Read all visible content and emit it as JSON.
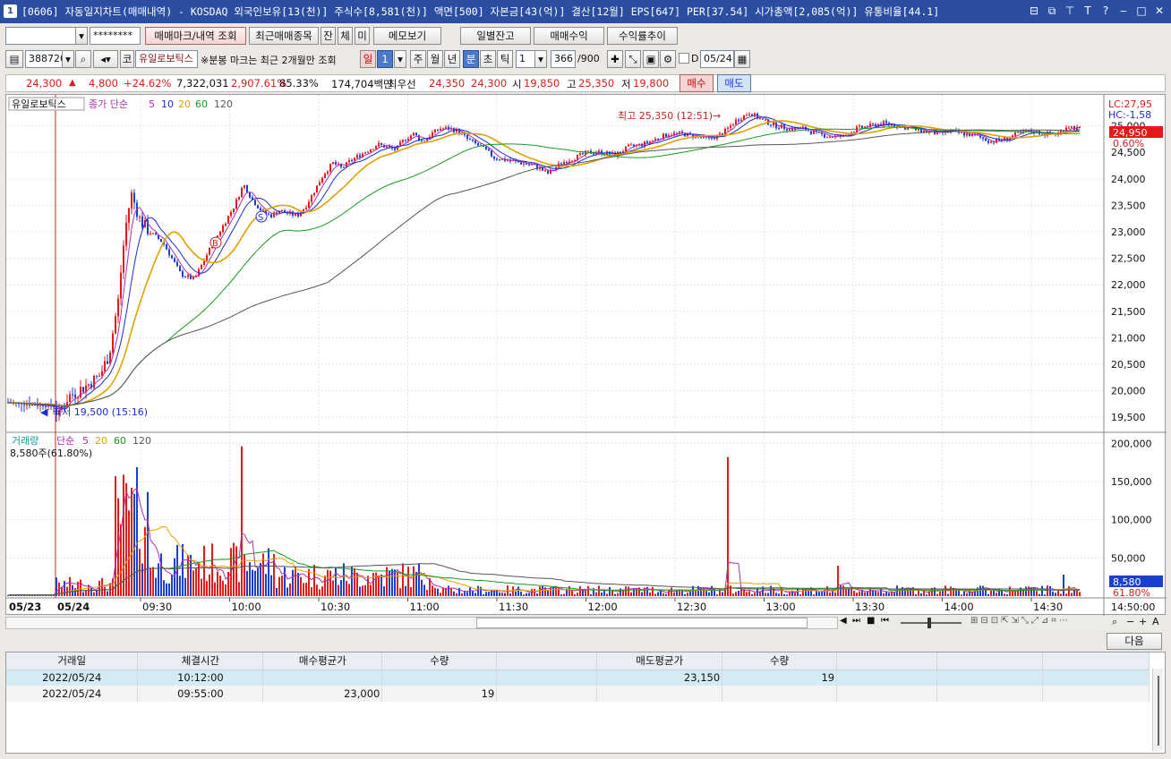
{
  "window": {
    "icon": "1",
    "title": "[0606] 자동일지차트(매매내역) - KOSDAQ 외국인보유[13(천)] 주식수[8,581(천)] 액면[500] 자본금[43(억)] 결산[12월] EPS[647] PER[37.54] 시가총액[2,085(억)] 유통비율[44.1]",
    "controls": [
      "⊟",
      "⧉",
      "⊤",
      "T",
      "?",
      "‒",
      "□",
      "✕"
    ]
  },
  "toolbar1": {
    "account_value": "",
    "password_mask": "********",
    "btn_trade_mark": "매매마크/내역 조회",
    "btn_recent": "최근매매종목",
    "btn_jan": "잔",
    "btn_che": "체",
    "btn_mi": "미",
    "btn_memo": "메모보기",
    "btn_daily_balance": "일별잔고",
    "btn_trade_profit": "매매수익",
    "btn_return_trend": "수익률추이"
  },
  "toolbar2": {
    "code": "388720",
    "market_badge": "코",
    "stock_name": "유일로보틱스",
    "notice": "※분봉 마크는 최근 2개월만 조회",
    "period_day": "일",
    "period_n": "1",
    "period_week": "주",
    "period_month": "월",
    "period_year": "년",
    "period_min": "분",
    "period_sec": "초",
    "period_tick": "틱",
    "tick_n": "1",
    "count": "366",
    "count_max": "/900",
    "d_label": "D",
    "date": "05/24"
  },
  "quote": {
    "price": "24,300",
    "up_arrow": "▲",
    "change": "4,800",
    "change_pct": "+24.62%",
    "volume": "7,322,031",
    "vol_ratio": "2,907.61%",
    "turnover": "85.33%",
    "amount": "174,704백만",
    "best_label": "최우선",
    "ask": "24,350",
    "bid": "24,300",
    "open_label": "시",
    "open": "19,850",
    "high_label": "고",
    "high": "25,350",
    "low_label": "저",
    "low": "19,800",
    "buy_btn": "매수",
    "sell_btn": "매도"
  },
  "chart_data": {
    "type": "candlestick",
    "price_panel": {
      "legend_name": "유일로보틱스",
      "legend_ma": "종가 단순",
      "ma_periods": [
        "5",
        "10",
        "20",
        "60",
        "120"
      ],
      "ma_colors": [
        "#1a2ec9",
        "#111111",
        "#e0a000",
        "#169c1e",
        "#555555"
      ],
      "y_ticks": [
        "25,000",
        "24,500",
        "24,000",
        "23,500",
        "23,000",
        "22,500",
        "22,000",
        "21,500",
        "21,000",
        "20,500",
        "20,000",
        "19,500"
      ],
      "ylim": [
        19300,
        25450
      ],
      "high_annotation": "최고 25,350 (12:51)",
      "low_annotation": "최저 19,500 (15:16)",
      "lc_label": "LC:27,95",
      "hc_label": "HC:-1,58",
      "last_price_label": "24,950",
      "last_pct_label": "0.60%",
      "marks": [
        "B",
        "S"
      ],
      "close_series_x": [
        0,
        55,
        56,
        70,
        90,
        105,
        115,
        125,
        130,
        135,
        140,
        150,
        160,
        175,
        185,
        195,
        210,
        225,
        235,
        245,
        255,
        265,
        275,
        285,
        295,
        305,
        315,
        325,
        335,
        345,
        355,
        365,
        375,
        385,
        395,
        405,
        415,
        425,
        435,
        445,
        455,
        465,
        475,
        485,
        495,
        505,
        515,
        525,
        535,
        545,
        560,
        575,
        590,
        605,
        620,
        635,
        650,
        665,
        680,
        695,
        710,
        725,
        740,
        755,
        770,
        785,
        800,
        815,
        830,
        845,
        860,
        875,
        890,
        905,
        920,
        935,
        950,
        965,
        980,
        995,
        1010,
        1025,
        1040,
        1055,
        1070,
        1085,
        1100,
        1115,
        1130,
        1145,
        1160,
        1175,
        1185,
        1196
      ],
      "close_series_y": [
        19780,
        19700,
        19550,
        19900,
        20100,
        20300,
        20700,
        21700,
        22600,
        23300,
        23700,
        23200,
        23000,
        22800,
        22500,
        22200,
        22100,
        22600,
        22900,
        23200,
        23500,
        23900,
        23600,
        23400,
        23300,
        23400,
        23350,
        23300,
        23500,
        23800,
        24100,
        24300,
        24200,
        24350,
        24450,
        24550,
        24650,
        24600,
        24550,
        24750,
        24850,
        24700,
        24850,
        24950,
        24950,
        24900,
        24750,
        24650,
        24550,
        24400,
        24350,
        24300,
        24250,
        24100,
        24300,
        24400,
        24500,
        24500,
        24450,
        24600,
        24650,
        24750,
        24850,
        24850,
        24800,
        24750,
        24850,
        25100,
        25250,
        25100,
        25000,
        24950,
        24950,
        24850,
        24800,
        24800,
        24950,
        25000,
        25050,
        25000,
        24950,
        24900,
        24850,
        24900,
        24850,
        24800,
        24700,
        24750,
        24850,
        24900,
        24850,
        24850,
        25000,
        24950
      ]
    },
    "volume_panel": {
      "legend_name": "거래량",
      "legend_ma": "단순",
      "ma_periods": [
        "5",
        "20",
        "60",
        "120"
      ],
      "current_label": "8,580주(61.80%)",
      "y_ticks": [
        "200,000",
        "150,000",
        "100,000",
        "50,000"
      ],
      "ylim": [
        0,
        205000
      ],
      "last_volume_label": "8,580",
      "last_pct_label": "61.80%"
    },
    "x_axis": {
      "date_labels": [
        "05/23",
        "05/24"
      ],
      "time_labels": [
        "09:30",
        "10:00",
        "10:30",
        "11:00",
        "11:30",
        "12:00",
        "12:30",
        "13:00",
        "13:30",
        "14:00",
        "14:30"
      ],
      "end_time": "14:50:00"
    }
  },
  "scroll_controls": [
    "◀",
    "▶",
    "⏮",
    "■",
    "⏭"
  ],
  "grid": {
    "next_btn": "다음",
    "headers": [
      "거래일",
      "체결시간",
      "매수평균가",
      "수량",
      "",
      "매도평균가",
      "수량",
      "",
      "",
      ""
    ],
    "rows": [
      [
        "2022/05/24",
        "10:12:00",
        "",
        "",
        "",
        "23,150",
        "19",
        "",
        "",
        ""
      ],
      [
        "2022/05/24",
        "09:55:00",
        "23,000",
        "19",
        "",
        "",
        "",
        "",
        "",
        ""
      ]
    ]
  }
}
